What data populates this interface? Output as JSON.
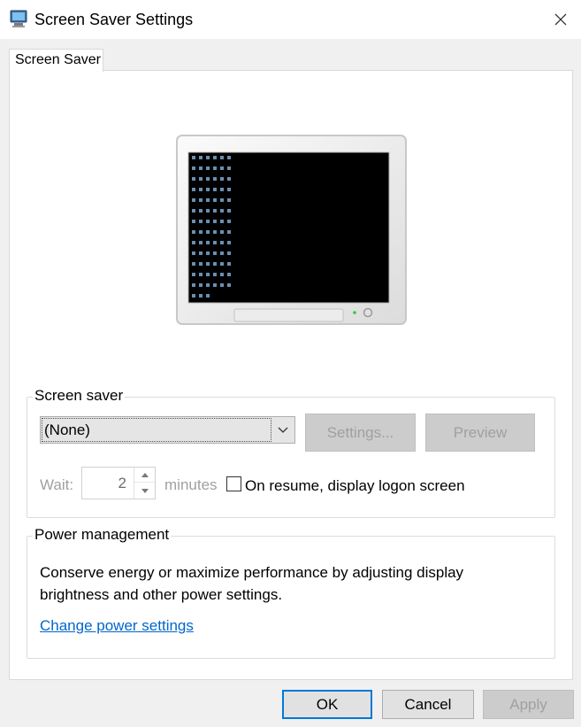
{
  "window": {
    "title": "Screen Saver Settings"
  },
  "tabs": [
    {
      "label": "Screen Saver",
      "active": true
    }
  ],
  "screen_saver": {
    "group_label": "Screen saver",
    "selected": "(None)",
    "settings_label": "Settings...",
    "preview_label": "Preview",
    "wait_label": "Wait:",
    "wait_value": "2",
    "minutes_label": "minutes",
    "logon_label": "On resume, display logon screen",
    "logon_checked": false
  },
  "power": {
    "group_label": "Power management",
    "description": "Conserve energy or maximize performance by adjusting display brightness and other power settings.",
    "link_label": "Change power settings"
  },
  "buttons": {
    "ok": "OK",
    "cancel": "Cancel",
    "apply": "Apply"
  },
  "icons": {
    "app": "screen-saver-icon",
    "close": "close-icon",
    "dropdown": "chevron-down-icon",
    "spin_up": "chevron-up-icon",
    "spin_down": "chevron-down-icon"
  },
  "colors": {
    "accent": "#0078d7",
    "link": "#0066cc",
    "disabled_text": "#a0a0a0"
  }
}
